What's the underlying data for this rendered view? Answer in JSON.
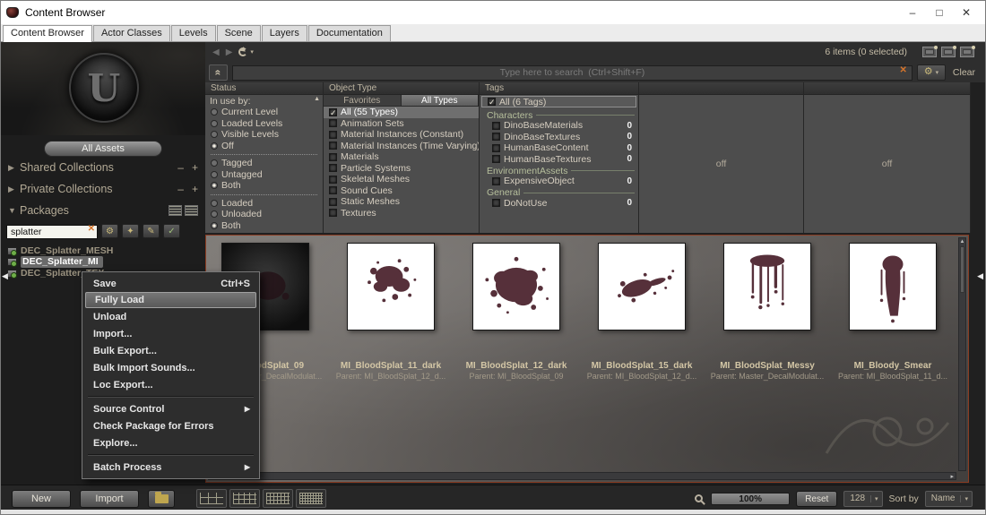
{
  "window": {
    "title": "Content Browser",
    "minimize": "–",
    "maximize": "□",
    "close": "✕"
  },
  "tabs": {
    "items": [
      "Content Browser",
      "Actor Classes",
      "Levels",
      "Scene",
      "Layers",
      "Documentation"
    ],
    "active": "Content Browser"
  },
  "sidebar": {
    "all_assets_label": "All Assets",
    "shared_collections_label": "Shared Collections",
    "private_collections_label": "Private Collections",
    "packages_label": "Packages",
    "search_value": "splatter",
    "packages": [
      "DEC_Splatter_MESH",
      "DEC_Splatter_MI",
      "DEC_Splatter_TEX"
    ],
    "selected_package": "DEC_Splatter_MI"
  },
  "toolbar": {
    "items_status": "6 items (0 selected)"
  },
  "search": {
    "placeholder": "Type here to search  (Ctrl+Shift+F)",
    "clear_label": "Clear"
  },
  "filters": {
    "status": {
      "header": "Status",
      "in_use_label": "In use by:",
      "use_options": [
        "Current Level",
        "Loaded Levels",
        "Visible Levels",
        "Off"
      ],
      "use_selected": "Off",
      "tag_options": [
        "Tagged",
        "Untagged",
        "Both"
      ],
      "tag_selected": "Both",
      "load_options": [
        "Loaded",
        "Unloaded",
        "Both"
      ],
      "load_selected": "Both"
    },
    "object_type": {
      "header": "Object Type",
      "tabs": [
        "Favorites",
        "All Types"
      ],
      "active_tab": "All Types",
      "options": [
        {
          "label": "All (55 Types)",
          "checked": true
        },
        {
          "label": "Animation Sets",
          "checked": false
        },
        {
          "label": "Material Instances (Constant)",
          "checked": false
        },
        {
          "label": "Material Instances (Time Varying)",
          "checked": false
        },
        {
          "label": "Materials",
          "checked": false
        },
        {
          "label": "Particle Systems",
          "checked": false
        },
        {
          "label": "Skeletal Meshes",
          "checked": false
        },
        {
          "label": "Sound Cues",
          "checked": false
        },
        {
          "label": "Static Meshes",
          "checked": false
        },
        {
          "label": "Textures",
          "checked": false
        }
      ]
    },
    "tags": {
      "header": "Tags",
      "all_label": "All (6 Tags)",
      "all_checked": true,
      "groups": [
        {
          "name": "Characters",
          "items": [
            {
              "label": "DinoBaseMaterials",
              "count": "0"
            },
            {
              "label": "DinoBaseTextures",
              "count": "0"
            },
            {
              "label": "HumanBaseContent",
              "count": "0"
            },
            {
              "label": "HumanBaseTextures",
              "count": "0"
            }
          ]
        },
        {
          "name": "EnvironmentAssets",
          "items": [
            {
              "label": "ExpensiveObject",
              "count": "0"
            }
          ]
        },
        {
          "name": "General",
          "items": [
            {
              "label": "DoNotUse",
              "count": "0"
            }
          ]
        }
      ]
    },
    "panel4_text": "off",
    "panel5_text": "off"
  },
  "assets": {
    "items": [
      {
        "name": "MI_BloodSplat_09",
        "parent": "Parent: Master_DecalModulat..."
      },
      {
        "name": "MI_BloodSplat_11_dark",
        "parent": "Parent: MI_BloodSplat_12_d..."
      },
      {
        "name": "MI_BloodSplat_12_dark",
        "parent": "Parent: MI_BloodSplat_09"
      },
      {
        "name": "MI_BloodSplat_15_dark",
        "parent": "Parent: MI_BloodSplat_12_d..."
      },
      {
        "name": "MI_BloodSplat_Messy",
        "parent": "Parent: Master_DecalModulat..."
      },
      {
        "name": "MI_Bloody_Smear",
        "parent": "Parent: MI_BloodSplat_11_d..."
      }
    ]
  },
  "context_menu": {
    "items": [
      {
        "label": "Save",
        "shortcut": "Ctrl+S"
      },
      {
        "label": "Fully Load",
        "highlighted": true
      },
      {
        "label": "Unload"
      },
      {
        "label": "Import..."
      },
      {
        "label": "Bulk Export..."
      },
      {
        "label": "Bulk Import Sounds..."
      },
      {
        "label": "Loc Export..."
      },
      {
        "label": "Source Control",
        "submenu": true
      },
      {
        "label": "Check Package for Errors"
      },
      {
        "label": "Explore..."
      },
      {
        "label": "Batch Process",
        "submenu": true
      }
    ]
  },
  "bottom_bar": {
    "new_label": "New",
    "import_label": "Import",
    "zoom_value": "100%",
    "reset_label": "Reset",
    "thumb_size": "128",
    "sort_by_label": "Sort by",
    "sort_value": "Name"
  },
  "icons": {
    "back": "◀",
    "forward": "▶",
    "caret": "▾",
    "collapse_chevrons": "«",
    "clear_x": "✕",
    "wrench": "⚙",
    "pencil": "✎",
    "check": "✓",
    "tag": "✦",
    "minus": "–",
    "plus": "+",
    "arrow_collapsed": "▶",
    "arrow_expanded": "▼",
    "scroll_up": "▲",
    "scroll_down": "▼",
    "scroll_right": "▸",
    "submenu_arrow": "▶",
    "checkmark": "✓",
    "edge_arrow": "◀",
    "u_logo": "U"
  },
  "colors": {
    "selection_border": "#8a3c22",
    "blood": "#56303a",
    "accent_text": "#c4bba6"
  }
}
